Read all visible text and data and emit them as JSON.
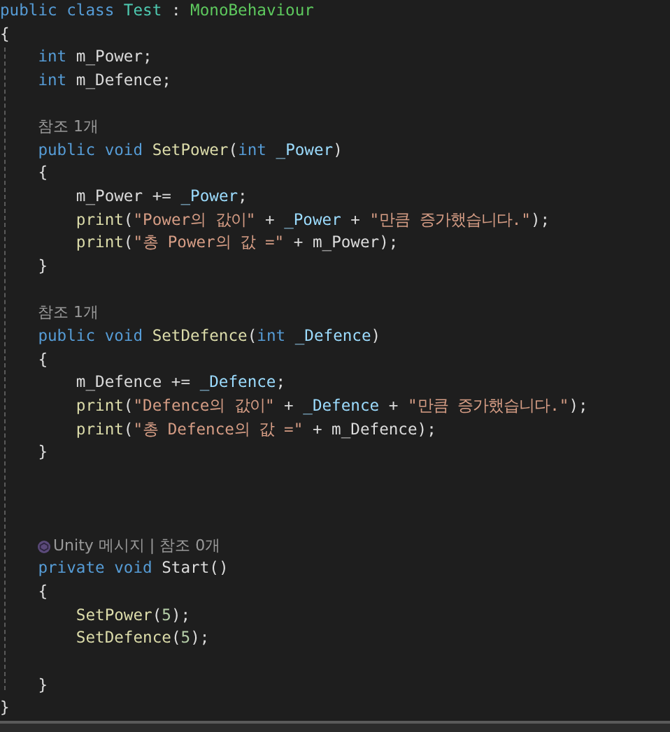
{
  "editor": {
    "lines": [
      {
        "kind": "code",
        "tokens": [
          {
            "text": "public class ",
            "kind": "keyword"
          },
          {
            "text": "Test",
            "kind": "class"
          },
          {
            "text": " : ",
            "kind": "plain"
          },
          {
            "text": "MonoBehaviour",
            "kind": "base"
          }
        ]
      },
      {
        "kind": "code",
        "tokens": [
          {
            "text": "{",
            "kind": "plain"
          }
        ]
      },
      {
        "kind": "code",
        "tokens": [
          {
            "text": "    int ",
            "kind": "keyword"
          },
          {
            "text": "m_Power;",
            "kind": "plain"
          }
        ]
      },
      {
        "kind": "code",
        "tokens": [
          {
            "text": "    int ",
            "kind": "keyword"
          },
          {
            "text": "m_Defence;",
            "kind": "plain"
          }
        ]
      },
      {
        "kind": "blank"
      },
      {
        "kind": "codelens",
        "text": "참조 1개"
      },
      {
        "kind": "code",
        "tokens": [
          {
            "text": "    public void ",
            "kind": "keyword"
          },
          {
            "text": "SetPower",
            "kind": "method"
          },
          {
            "text": "(",
            "kind": "plain"
          },
          {
            "text": "int ",
            "kind": "keyword"
          },
          {
            "text": "_Power",
            "kind": "param"
          },
          {
            "text": ")",
            "kind": "plain"
          }
        ]
      },
      {
        "kind": "code",
        "tokens": [
          {
            "text": "    {",
            "kind": "plain"
          }
        ]
      },
      {
        "kind": "code",
        "tokens": [
          {
            "text": "        m_Power += ",
            "kind": "plain"
          },
          {
            "text": "_Power",
            "kind": "param"
          },
          {
            "text": ";",
            "kind": "plain"
          }
        ]
      },
      {
        "kind": "code",
        "tokens": [
          {
            "text": "        print",
            "kind": "method"
          },
          {
            "text": "(",
            "kind": "plain"
          },
          {
            "text": "\"Power의 값이\"",
            "kind": "string"
          },
          {
            "text": " + ",
            "kind": "plain"
          },
          {
            "text": "_Power",
            "kind": "param"
          },
          {
            "text": " + ",
            "kind": "plain"
          },
          {
            "text": "\"만큼 증가했습니다.\"",
            "kind": "string"
          },
          {
            "text": ");",
            "kind": "plain"
          }
        ]
      },
      {
        "kind": "code",
        "tokens": [
          {
            "text": "        print",
            "kind": "method"
          },
          {
            "text": "(",
            "kind": "plain"
          },
          {
            "text": "\"총 Power의 값 =\"",
            "kind": "string"
          },
          {
            "text": " + m_Power);",
            "kind": "plain"
          }
        ]
      },
      {
        "kind": "code",
        "tokens": [
          {
            "text": "    }",
            "kind": "plain"
          }
        ]
      },
      {
        "kind": "blank"
      },
      {
        "kind": "codelens",
        "text": "참조 1개"
      },
      {
        "kind": "code",
        "tokens": [
          {
            "text": "    public void ",
            "kind": "keyword"
          },
          {
            "text": "SetDefence",
            "kind": "method"
          },
          {
            "text": "(",
            "kind": "plain"
          },
          {
            "text": "int ",
            "kind": "keyword"
          },
          {
            "text": "_Defence",
            "kind": "param"
          },
          {
            "text": ")",
            "kind": "plain"
          }
        ]
      },
      {
        "kind": "code",
        "tokens": [
          {
            "text": "    {",
            "kind": "plain"
          }
        ]
      },
      {
        "kind": "code",
        "tokens": [
          {
            "text": "        m_Defence += ",
            "kind": "plain"
          },
          {
            "text": "_Defence",
            "kind": "param"
          },
          {
            "text": ";",
            "kind": "plain"
          }
        ]
      },
      {
        "kind": "code",
        "tokens": [
          {
            "text": "        print",
            "kind": "method"
          },
          {
            "text": "(",
            "kind": "plain"
          },
          {
            "text": "\"Defence의 값이\"",
            "kind": "string"
          },
          {
            "text": " + ",
            "kind": "plain"
          },
          {
            "text": "_Defence",
            "kind": "param"
          },
          {
            "text": " + ",
            "kind": "plain"
          },
          {
            "text": "\"만큼 증가했습니다.\"",
            "kind": "string"
          },
          {
            "text": ");",
            "kind": "plain"
          }
        ]
      },
      {
        "kind": "code",
        "tokens": [
          {
            "text": "        print",
            "kind": "method"
          },
          {
            "text": "(",
            "kind": "plain"
          },
          {
            "text": "\"총 Defence의 값 =\"",
            "kind": "string"
          },
          {
            "text": " + m_Defence);",
            "kind": "plain"
          }
        ]
      },
      {
        "kind": "code",
        "tokens": [
          {
            "text": "    }",
            "kind": "plain"
          }
        ]
      },
      {
        "kind": "blank"
      },
      {
        "kind": "blank"
      },
      {
        "kind": "blank"
      },
      {
        "kind": "unity_codelens",
        "text": "Unity 메시지 | 참조 0개"
      },
      {
        "kind": "code",
        "tokens": [
          {
            "text": "    private void ",
            "kind": "keyword"
          },
          {
            "text": "Start",
            "kind": "plain"
          },
          {
            "text": "()",
            "kind": "plain"
          }
        ]
      },
      {
        "kind": "code",
        "tokens": [
          {
            "text": "    {",
            "kind": "plain"
          }
        ]
      },
      {
        "kind": "code",
        "tokens": [
          {
            "text": "        SetPower",
            "kind": "method"
          },
          {
            "text": "(",
            "kind": "plain"
          },
          {
            "text": "5",
            "kind": "number"
          },
          {
            "text": ");",
            "kind": "plain"
          }
        ]
      },
      {
        "kind": "code",
        "tokens": [
          {
            "text": "        SetDefence",
            "kind": "method"
          },
          {
            "text": "(",
            "kind": "plain"
          },
          {
            "text": "5",
            "kind": "number"
          },
          {
            "text": ");",
            "kind": "plain"
          }
        ]
      },
      {
        "kind": "blank"
      },
      {
        "kind": "code",
        "tokens": [
          {
            "text": "    }",
            "kind": "plain"
          }
        ]
      },
      {
        "kind": "code",
        "tokens": [
          {
            "text": "}",
            "kind": "plain"
          }
        ]
      }
    ]
  }
}
